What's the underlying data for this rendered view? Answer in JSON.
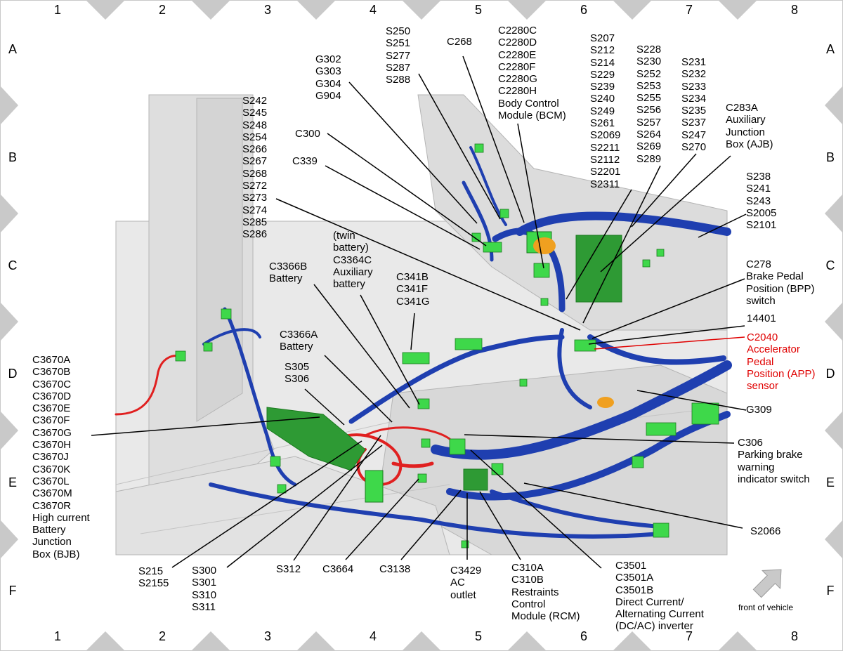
{
  "grid": {
    "columns": [
      "1",
      "2",
      "3",
      "4",
      "5",
      "6",
      "7",
      "8"
    ],
    "rows": [
      "A",
      "B",
      "C",
      "D",
      "E",
      "F"
    ]
  },
  "colors": {
    "wire_harness": "#1f3fb0",
    "connector": "#3ed84a",
    "highlight_wire": "#e02020",
    "body_panel": "#e6e6e6",
    "leader_red": "#e00000"
  },
  "callouts": {
    "s242_group": [
      "S242",
      "S245",
      "S248",
      "S254",
      "S266",
      "S267",
      "S268",
      "S272",
      "S273",
      "S274",
      "S285",
      "S286"
    ],
    "g302_group": [
      "G302",
      "G303",
      "G304",
      "G904"
    ],
    "s250_group": [
      "S250",
      "S251",
      "S277",
      "S287",
      "S288"
    ],
    "c268": [
      "C268"
    ],
    "c2280_group": [
      "C2280C",
      "C2280D",
      "C2280E",
      "C2280F",
      "C2280G",
      "C2280H",
      "Body Control",
      "Module (BCM)"
    ],
    "s207_group": [
      "S207",
      "S212",
      "S214",
      "S229",
      "S239",
      "S240",
      "S249",
      "S261",
      "S2069",
      "S2211",
      "S2112",
      "S2201",
      "S2311"
    ],
    "s228_group": [
      "S228",
      "S230",
      "S252",
      "S253",
      "S255",
      "S256",
      "S257",
      "S264",
      "S269",
      "S289"
    ],
    "s231_group": [
      "S231",
      "S232",
      "S233",
      "S234",
      "S235",
      "S237",
      "S247",
      "S270"
    ],
    "c283a": [
      "C283A",
      "Auxiliary",
      "Junction",
      "Box (AJB)"
    ],
    "c300": [
      "C300"
    ],
    "c339": [
      "C339"
    ],
    "s238_group": [
      "S238",
      "S241",
      "S243",
      "S2005",
      "S2101"
    ],
    "c3364c": [
      "(twin",
      "battery)",
      "C3364C",
      "Auxiliary",
      "battery"
    ],
    "c3366b": [
      "C3366B",
      "Battery"
    ],
    "c341_group": [
      "C341B",
      "C341F",
      "C341G"
    ],
    "c278": [
      "C278",
      "Brake Pedal",
      "Position (BPP)",
      "switch"
    ],
    "n14401": [
      "14401"
    ],
    "c2040": [
      "C2040",
      "Accelerator",
      "Pedal",
      "Position (APP)",
      "sensor"
    ],
    "c3366a": [
      "C3366A",
      "Battery"
    ],
    "s305_group": [
      "S305",
      "S306"
    ],
    "c3670_group": [
      "C3670A",
      "C3670B",
      "C3670C",
      "C3670D",
      "C3670E",
      "C3670F",
      "C3670G",
      "C3670H",
      "C3670J",
      "C3670K",
      "C3670L",
      "C3670M",
      "C3670R",
      "High current",
      "Battery",
      "Junction",
      "Box (BJB)"
    ],
    "g309": [
      "G309"
    ],
    "c306": [
      "C306",
      "Parking brake",
      "warning",
      "indicator switch"
    ],
    "s2066": [
      "S2066"
    ],
    "s215_group": [
      "S215",
      "S2155"
    ],
    "s300_group": [
      "S300",
      "S301",
      "S310",
      "S311"
    ],
    "s312": [
      "S312"
    ],
    "c3664": [
      "C3664"
    ],
    "c3138": [
      "C3138"
    ],
    "c3429": [
      "C3429",
      "AC",
      "outlet"
    ],
    "c310": [
      "C310A",
      "C310B",
      "Restraints",
      "Control",
      "Module (RCM)"
    ],
    "c3501": [
      "C3501",
      "C3501A",
      "C3501B",
      "Direct Current/",
      "Alternating Current",
      "(DC/AC) inverter"
    ]
  },
  "front_of_vehicle": "front of vehicle"
}
